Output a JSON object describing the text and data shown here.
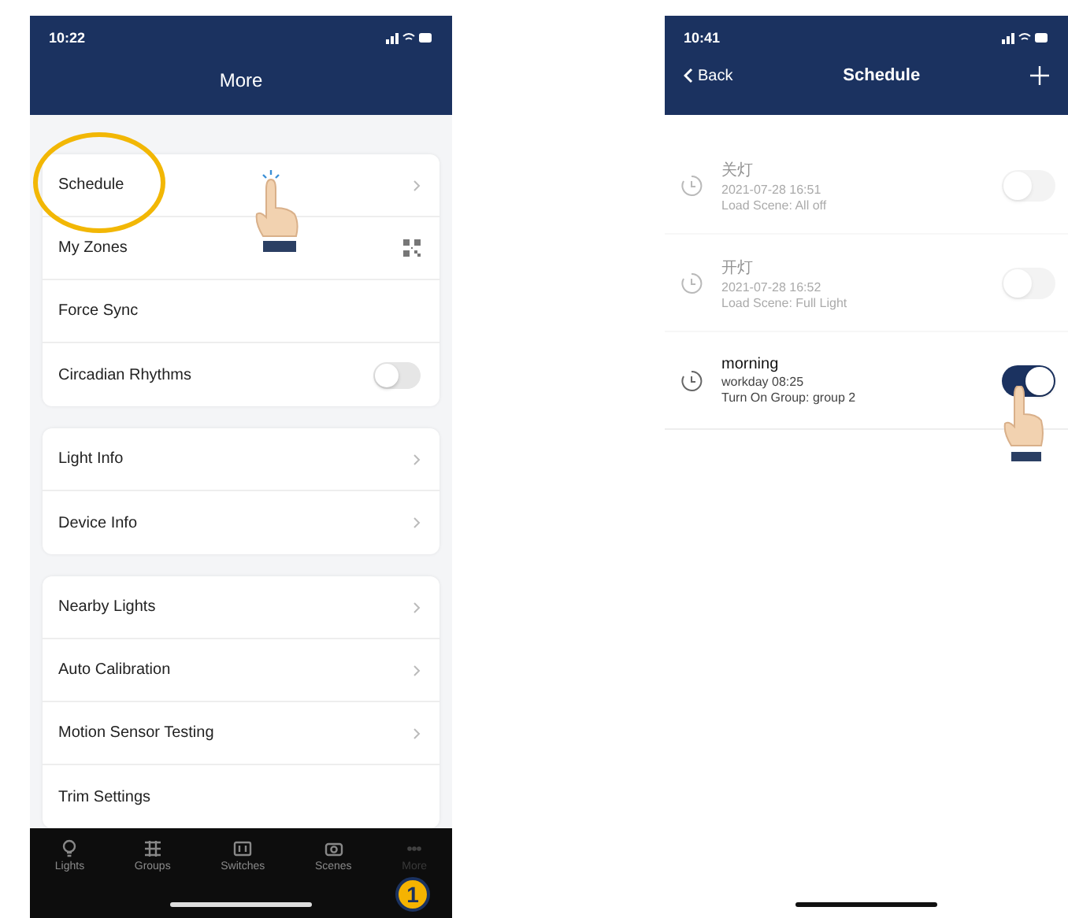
{
  "left_screen": {
    "status_bar": {
      "time": "10:22"
    },
    "title": "More",
    "groups": [
      {
        "rows": [
          {
            "label": "Schedule",
            "kind": "chevron"
          },
          {
            "label": "My Zones",
            "kind": "qr"
          },
          {
            "label": "Force Sync",
            "kind": "plain"
          },
          {
            "label": "Circadian Rhythms",
            "kind": "toggle",
            "on": false
          }
        ]
      },
      {
        "rows": [
          {
            "label": "Light Info",
            "kind": "chevron"
          },
          {
            "label": "Device Info",
            "kind": "chevron"
          }
        ]
      },
      {
        "rows": [
          {
            "label": "Nearby Lights",
            "kind": "chevron"
          },
          {
            "label": "Auto Calibration",
            "kind": "chevron"
          },
          {
            "label": "Motion Sensor Testing",
            "kind": "chevron"
          },
          {
            "label": "Trim Settings",
            "kind": "plain"
          }
        ]
      }
    ],
    "tab_bar": [
      {
        "label": "Lights",
        "selected": false
      },
      {
        "label": "Groups",
        "selected": false
      },
      {
        "label": "Switches",
        "selected": false
      },
      {
        "label": "Scenes",
        "selected": false
      },
      {
        "label": "More",
        "selected": true
      }
    ],
    "step_badge": "1"
  },
  "right_screen": {
    "status_bar": {
      "time": "10:41"
    },
    "back": "Back",
    "title": "Schedule",
    "schedules": [
      {
        "name": "关灯",
        "when": "2021-07-28 16:51",
        "action": "Load Scene: All off",
        "on": false
      },
      {
        "name": "开灯",
        "when": "2021-07-28 16:52",
        "action": "Load Scene: Full Light",
        "on": false
      },
      {
        "name": "morning",
        "when": "workday 08:25",
        "action": "Turn On Group: group 2",
        "on": true
      }
    ]
  }
}
